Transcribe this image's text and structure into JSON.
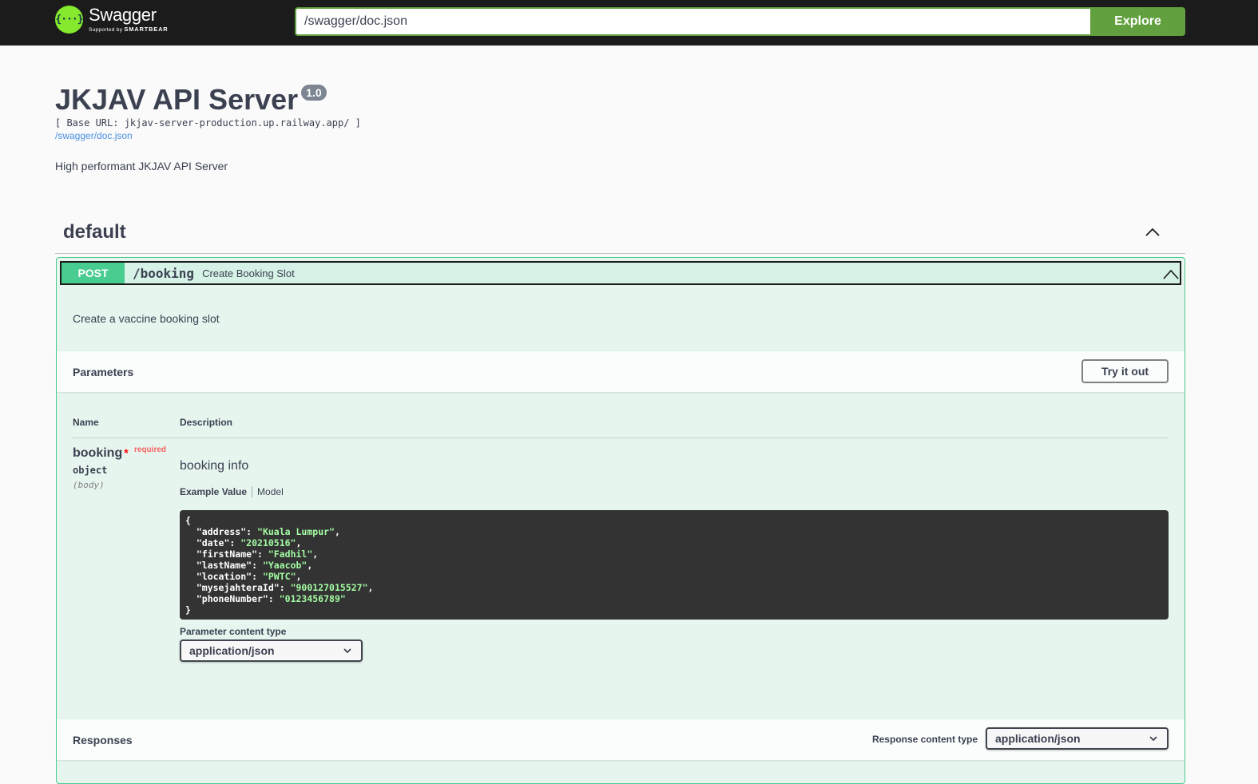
{
  "topbar": {
    "logo_name": "Swagger",
    "logo_sub_prefix": "Supported by",
    "logo_sub_brand": "SMARTBEAR",
    "url_value": "/swagger/doc.json",
    "explore_label": "Explore"
  },
  "info": {
    "title": "JKJAV API Server",
    "version": "1.0",
    "base_url": "[ Base URL: jkjav-server-production.up.railway.app/ ]",
    "spec_link": "/swagger/doc.json",
    "description": "High performant JKJAV API Server"
  },
  "tag": {
    "name": "default"
  },
  "operation": {
    "method": "POST",
    "path": "/booking",
    "summary": "Create Booking Slot",
    "description": "Create a vaccine booking slot",
    "parameters_title": "Parameters",
    "try_it_out_label": "Try it out",
    "columns": {
      "name": "Name",
      "description": "Description"
    },
    "param": {
      "name": "booking",
      "required_star": "*",
      "required_label": "required",
      "type": "object",
      "in": "(body)",
      "description": "booking info",
      "tab_example": "Example Value",
      "tab_model": "Model",
      "example": [
        {
          "key": "address",
          "value": "Kuala Lumpur"
        },
        {
          "key": "date",
          "value": "20210516"
        },
        {
          "key": "firstName",
          "value": "Fadhil"
        },
        {
          "key": "lastName",
          "value": "Yaacob"
        },
        {
          "key": "location",
          "value": "PWTC"
        },
        {
          "key": "mysejahteraId",
          "value": "900127015527"
        },
        {
          "key": "phoneNumber",
          "value": "0123456789"
        }
      ],
      "content_type_label": "Parameter content type",
      "content_type_value": "application/json"
    },
    "responses_title": "Responses",
    "response_content_type_label": "Response content type",
    "response_content_type_value": "application/json"
  },
  "colors": {
    "topbar_bg": "#1b1b1b",
    "accent_green": "#62a03f",
    "post_green": "#49cc90",
    "code_bg": "#333333",
    "code_string": "#a2fca2"
  }
}
